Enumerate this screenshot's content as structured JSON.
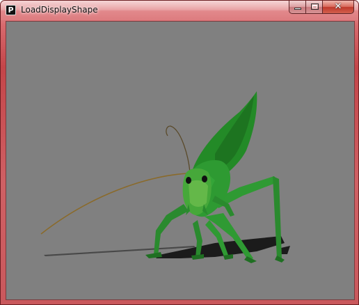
{
  "window": {
    "title": "LoadDisplayShape",
    "app_icon_letter": "P"
  },
  "caption_buttons": {
    "minimize": "minimize",
    "maximize": "maximize",
    "close": "close"
  },
  "canvas": {
    "background_color": "#808080",
    "shape": "grasshopper"
  }
}
